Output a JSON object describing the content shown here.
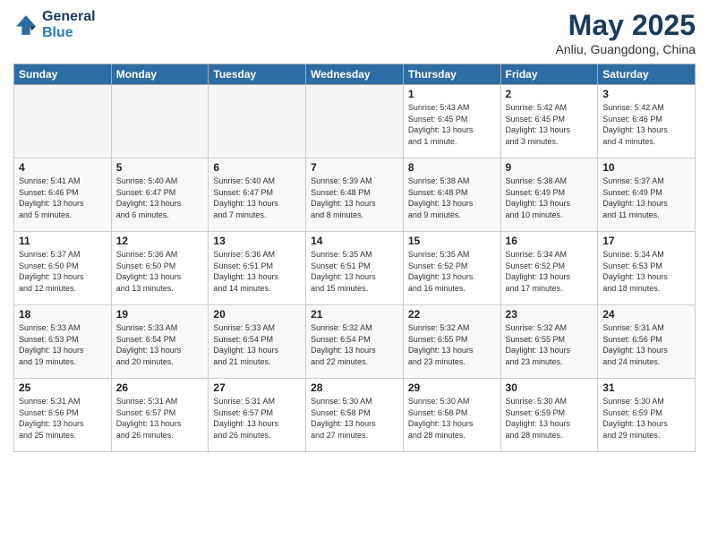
{
  "header": {
    "logo_line1": "General",
    "logo_line2": "Blue",
    "title": "May 2025",
    "location": "Anliu, Guangdong, China"
  },
  "weekdays": [
    "Sunday",
    "Monday",
    "Tuesday",
    "Wednesday",
    "Thursday",
    "Friday",
    "Saturday"
  ],
  "weeks": [
    [
      {
        "day": "",
        "info": ""
      },
      {
        "day": "",
        "info": ""
      },
      {
        "day": "",
        "info": ""
      },
      {
        "day": "",
        "info": ""
      },
      {
        "day": "1",
        "info": "Sunrise: 5:43 AM\nSunset: 6:45 PM\nDaylight: 13 hours\nand 1 minute."
      },
      {
        "day": "2",
        "info": "Sunrise: 5:42 AM\nSunset: 6:45 PM\nDaylight: 13 hours\nand 3 minutes."
      },
      {
        "day": "3",
        "info": "Sunrise: 5:42 AM\nSunset: 6:46 PM\nDaylight: 13 hours\nand 4 minutes."
      }
    ],
    [
      {
        "day": "4",
        "info": "Sunrise: 5:41 AM\nSunset: 6:46 PM\nDaylight: 13 hours\nand 5 minutes."
      },
      {
        "day": "5",
        "info": "Sunrise: 5:40 AM\nSunset: 6:47 PM\nDaylight: 13 hours\nand 6 minutes."
      },
      {
        "day": "6",
        "info": "Sunrise: 5:40 AM\nSunset: 6:47 PM\nDaylight: 13 hours\nand 7 minutes."
      },
      {
        "day": "7",
        "info": "Sunrise: 5:39 AM\nSunset: 6:48 PM\nDaylight: 13 hours\nand 8 minutes."
      },
      {
        "day": "8",
        "info": "Sunrise: 5:38 AM\nSunset: 6:48 PM\nDaylight: 13 hours\nand 9 minutes."
      },
      {
        "day": "9",
        "info": "Sunrise: 5:38 AM\nSunset: 6:49 PM\nDaylight: 13 hours\nand 10 minutes."
      },
      {
        "day": "10",
        "info": "Sunrise: 5:37 AM\nSunset: 6:49 PM\nDaylight: 13 hours\nand 11 minutes."
      }
    ],
    [
      {
        "day": "11",
        "info": "Sunrise: 5:37 AM\nSunset: 6:50 PM\nDaylight: 13 hours\nand 12 minutes."
      },
      {
        "day": "12",
        "info": "Sunrise: 5:36 AM\nSunset: 6:50 PM\nDaylight: 13 hours\nand 13 minutes."
      },
      {
        "day": "13",
        "info": "Sunrise: 5:36 AM\nSunset: 6:51 PM\nDaylight: 13 hours\nand 14 minutes."
      },
      {
        "day": "14",
        "info": "Sunrise: 5:35 AM\nSunset: 6:51 PM\nDaylight: 13 hours\nand 15 minutes."
      },
      {
        "day": "15",
        "info": "Sunrise: 5:35 AM\nSunset: 6:52 PM\nDaylight: 13 hours\nand 16 minutes."
      },
      {
        "day": "16",
        "info": "Sunrise: 5:34 AM\nSunset: 6:52 PM\nDaylight: 13 hours\nand 17 minutes."
      },
      {
        "day": "17",
        "info": "Sunrise: 5:34 AM\nSunset: 6:53 PM\nDaylight: 13 hours\nand 18 minutes."
      }
    ],
    [
      {
        "day": "18",
        "info": "Sunrise: 5:33 AM\nSunset: 6:53 PM\nDaylight: 13 hours\nand 19 minutes."
      },
      {
        "day": "19",
        "info": "Sunrise: 5:33 AM\nSunset: 6:54 PM\nDaylight: 13 hours\nand 20 minutes."
      },
      {
        "day": "20",
        "info": "Sunrise: 5:33 AM\nSunset: 6:54 PM\nDaylight: 13 hours\nand 21 minutes."
      },
      {
        "day": "21",
        "info": "Sunrise: 5:32 AM\nSunset: 6:54 PM\nDaylight: 13 hours\nand 22 minutes."
      },
      {
        "day": "22",
        "info": "Sunrise: 5:32 AM\nSunset: 6:55 PM\nDaylight: 13 hours\nand 23 minutes."
      },
      {
        "day": "23",
        "info": "Sunrise: 5:32 AM\nSunset: 6:55 PM\nDaylight: 13 hours\nand 23 minutes."
      },
      {
        "day": "24",
        "info": "Sunrise: 5:31 AM\nSunset: 6:56 PM\nDaylight: 13 hours\nand 24 minutes."
      }
    ],
    [
      {
        "day": "25",
        "info": "Sunrise: 5:31 AM\nSunset: 6:56 PM\nDaylight: 13 hours\nand 25 minutes."
      },
      {
        "day": "26",
        "info": "Sunrise: 5:31 AM\nSunset: 6:57 PM\nDaylight: 13 hours\nand 26 minutes."
      },
      {
        "day": "27",
        "info": "Sunrise: 5:31 AM\nSunset: 6:57 PM\nDaylight: 13 hours\nand 26 minutes."
      },
      {
        "day": "28",
        "info": "Sunrise: 5:30 AM\nSunset: 6:58 PM\nDaylight: 13 hours\nand 27 minutes."
      },
      {
        "day": "29",
        "info": "Sunrise: 5:30 AM\nSunset: 6:58 PM\nDaylight: 13 hours\nand 28 minutes."
      },
      {
        "day": "30",
        "info": "Sunrise: 5:30 AM\nSunset: 6:59 PM\nDaylight: 13 hours\nand 28 minutes."
      },
      {
        "day": "31",
        "info": "Sunrise: 5:30 AM\nSunset: 6:59 PM\nDaylight: 13 hours\nand 29 minutes."
      }
    ]
  ]
}
